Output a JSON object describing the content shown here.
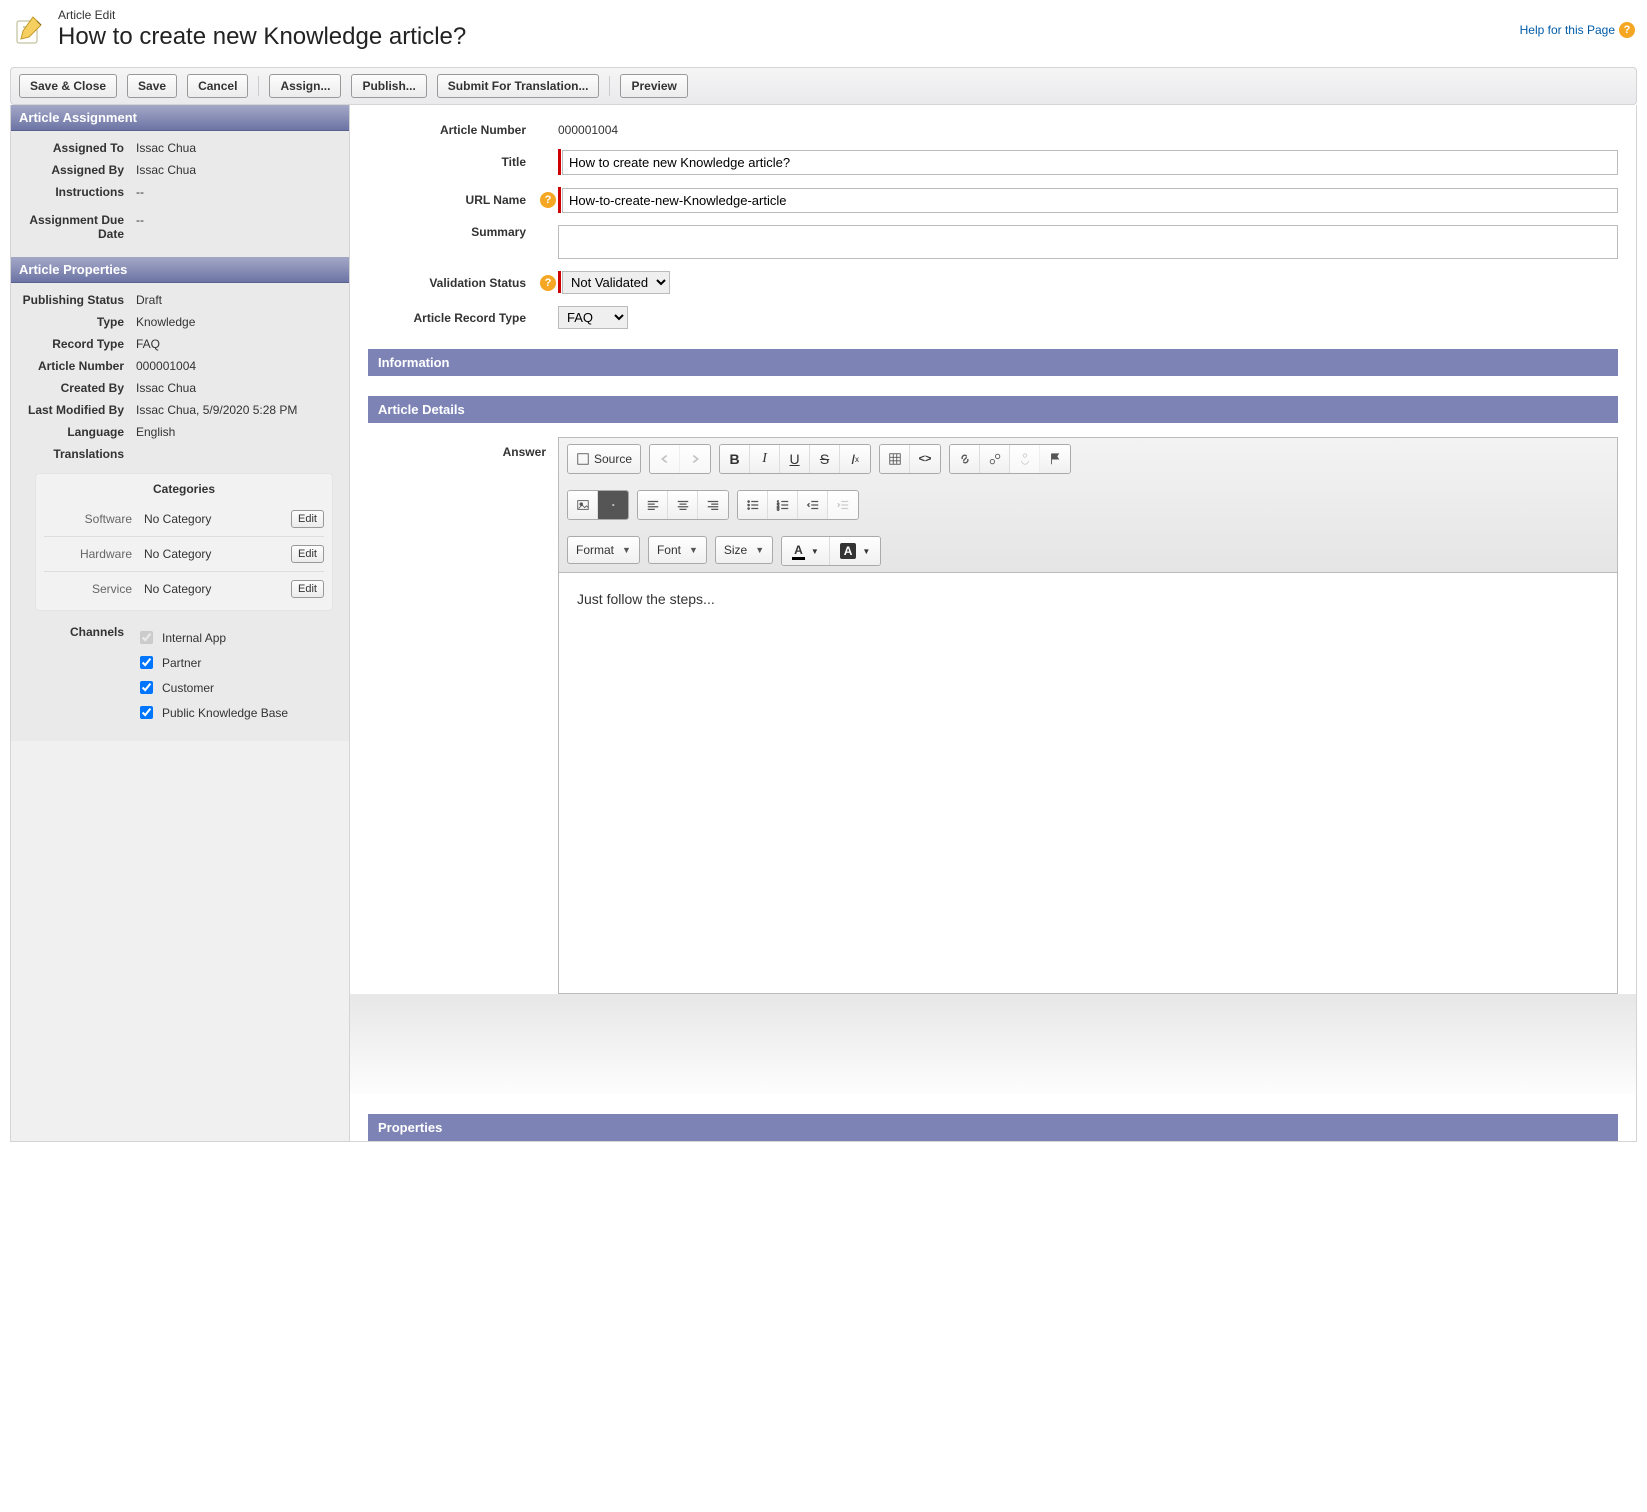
{
  "header": {
    "subtitle": "Article Edit",
    "title": "How to create new Knowledge article?",
    "help_label": "Help for this Page"
  },
  "toolbar": {
    "save_close": "Save & Close",
    "save": "Save",
    "cancel": "Cancel",
    "assign": "Assign...",
    "publish": "Publish...",
    "submit_translation": "Submit For Translation...",
    "preview": "Preview"
  },
  "sidebar": {
    "assignment_head": "Article Assignment",
    "properties_head": "Article Properties",
    "assignment": {
      "assigned_to_lbl": "Assigned To",
      "assigned_to": "Issac Chua",
      "assigned_by_lbl": "Assigned By",
      "assigned_by": "Issac Chua",
      "instructions_lbl": "Instructions",
      "instructions": "--",
      "due_lbl": "Assignment Due Date",
      "due": "--"
    },
    "properties": {
      "pub_status_lbl": "Publishing Status",
      "pub_status": "Draft",
      "type_lbl": "Type",
      "type": "Knowledge",
      "record_type_lbl": "Record Type",
      "record_type": "FAQ",
      "article_number_lbl": "Article Number",
      "article_number": "000001004",
      "created_by_lbl": "Created By",
      "created_by": "Issac Chua",
      "last_mod_lbl": "Last Modified By",
      "last_mod": "Issac Chua, 5/9/2020 5:28 PM",
      "language_lbl": "Language",
      "language": "English",
      "translations_lbl": "Translations",
      "translations": ""
    },
    "categories": {
      "title": "Categories",
      "edit": "Edit",
      "rows": [
        {
          "label": "Software",
          "value": "No Category"
        },
        {
          "label": "Hardware",
          "value": "No Category"
        },
        {
          "label": "Service",
          "value": "No Category"
        }
      ]
    },
    "channels": {
      "label": "Channels",
      "items": [
        {
          "label": "Internal App",
          "checked": true,
          "disabled": true
        },
        {
          "label": "Partner",
          "checked": true,
          "disabled": false
        },
        {
          "label": "Customer",
          "checked": true,
          "disabled": false
        },
        {
          "label": "Public Knowledge Base",
          "checked": true,
          "disabled": false
        }
      ]
    }
  },
  "main": {
    "article_number_lbl": "Article Number",
    "article_number": "000001004",
    "title_lbl": "Title",
    "title_val": "How to create new Knowledge article?",
    "url_lbl": "URL Name",
    "url_val": "How-to-create-new-Knowledge-article",
    "summary_lbl": "Summary",
    "summary_val": "",
    "validation_lbl": "Validation Status",
    "validation_val": "Not Validated",
    "record_type_lbl": "Article Record Type",
    "record_type_val": "FAQ",
    "section_information": "Information",
    "section_details": "Article Details",
    "section_properties": "Properties",
    "answer_lbl": "Answer",
    "answer_content": "Just follow the steps..."
  },
  "editor": {
    "source": "Source",
    "format": "Format",
    "font": "Font",
    "size": "Size"
  }
}
